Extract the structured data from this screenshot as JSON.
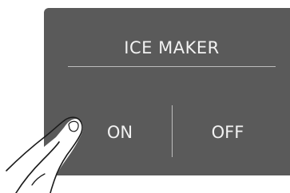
{
  "panel": {
    "title": "ICE MAKER",
    "on_label": "ON",
    "off_label": "OFF"
  },
  "colors": {
    "panel_background": "#5a5a5a",
    "text": "#f2f2f2",
    "divider": "#bdbdbd"
  },
  "icons": {
    "pointing_hand": "finger-press-icon"
  }
}
